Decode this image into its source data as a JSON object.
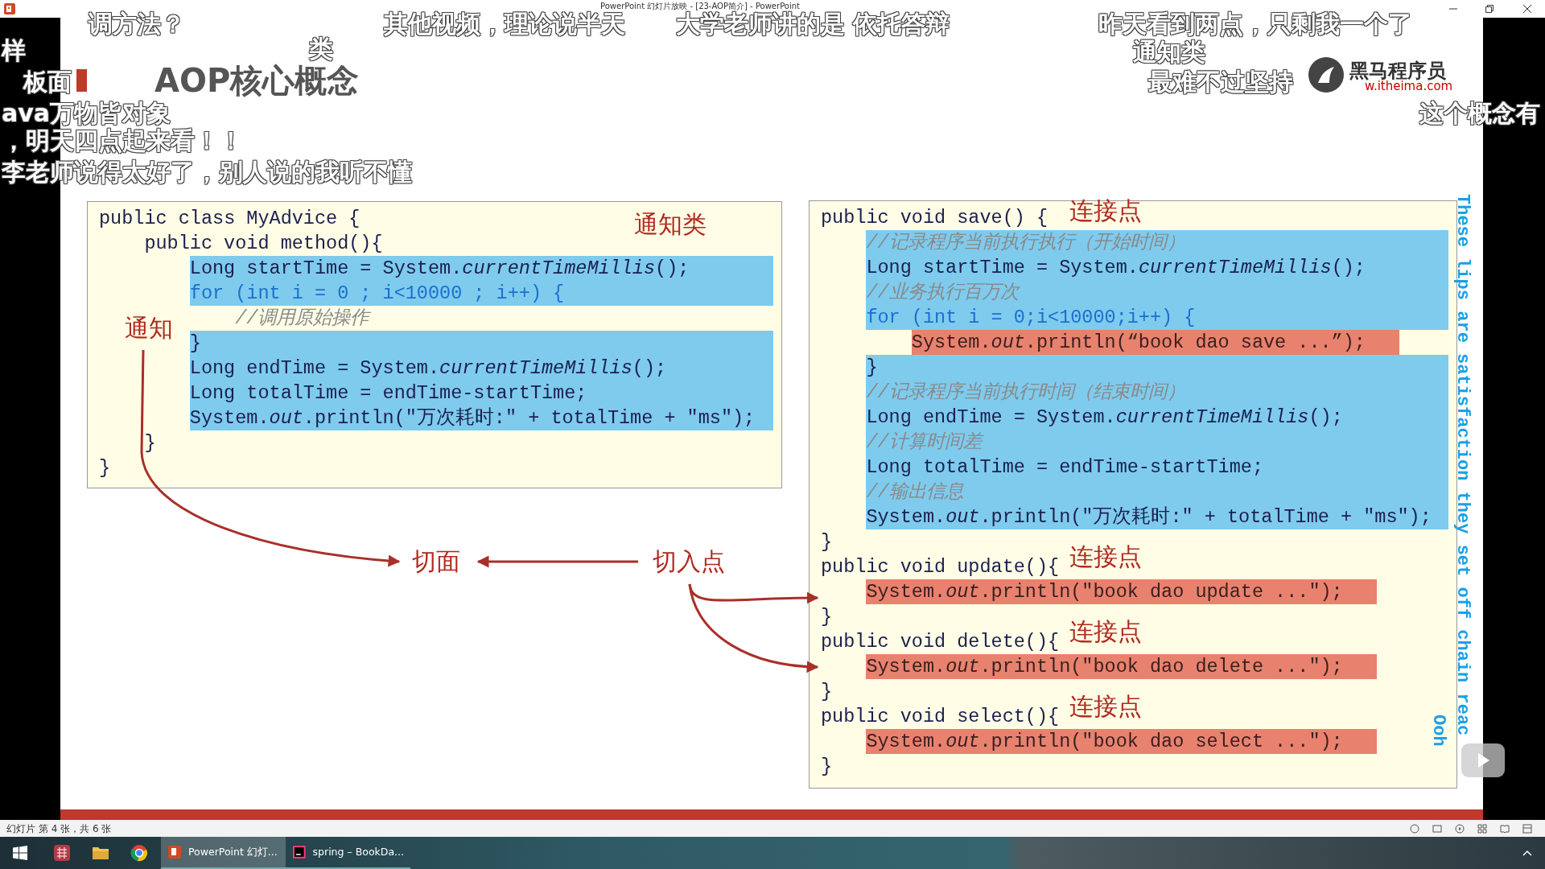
{
  "window": {
    "title": "PowerPoint 幻灯片放映 - [23-AOP简介] - PowerPoint"
  },
  "slide": {
    "title": "AOP核心概念",
    "logo": {
      "name": "黑马程序员",
      "url": "w.itheima.com"
    },
    "advice_class": {
      "lines": [
        {
          "text": "public class MyAdvice {",
          "kind": "code"
        },
        {
          "text": "    public void method(){",
          "kind": "code"
        },
        {
          "text": "        Long startTime = System.*currentTimeMillis*();",
          "kind": "code",
          "color": "#7ecbee"
        },
        {
          "text": "        for (int i = 0 ; i<10000 ; i++) {",
          "kind": "loop",
          "color": "#7ecbee"
        },
        {
          "text": "            //调用原始操作",
          "kind": "comment"
        },
        {
          "text": "        }",
          "kind": "code",
          "color": "#7ecbee"
        },
        {
          "text": "        Long endTime = System.*currentTimeMillis*();",
          "kind": "code",
          "color": "#7ecbee"
        },
        {
          "text": "        Long totalTime = endTime-startTime;",
          "kind": "code",
          "color": "#7ecbee"
        },
        {
          "text": "        System.*out*.println(\"万次耗时:\" + totalTime + \"ms\");",
          "kind": "code",
          "color": "#7ecbee"
        },
        {
          "text": "    }",
          "kind": "code"
        },
        {
          "text": "}",
          "kind": "code"
        }
      ]
    },
    "target_class": {
      "lines": [
        {
          "text": "public void save() {",
          "kind": "code"
        },
        {
          "text": "    //记录程序当前执行执行（开始时间）",
          "kind": "comment",
          "color": "#7ecbee"
        },
        {
          "text": "    Long startTime = System.*currentTimeMillis*();",
          "kind": "code",
          "color": "#7ecbee"
        },
        {
          "text": "    //业务执行百万次",
          "kind": "comment",
          "color": "#7ecbee"
        },
        {
          "text": "    for (int i = 0;i<10000;i++) {",
          "kind": "loop",
          "color": "#7ecbee"
        },
        {
          "text": "        System.*out*.println(“book dao save ...”);",
          "kind": "joinpoint",
          "color": "#e8826e"
        },
        {
          "text": "    }",
          "kind": "code",
          "color": "#7ecbee"
        },
        {
          "text": "    //记录程序当前执行时间（结束时间）",
          "kind": "comment",
          "color": "#7ecbee"
        },
        {
          "text": "    Long endTime = System.*currentTimeMillis*();",
          "kind": "code",
          "color": "#7ecbee"
        },
        {
          "text": "    //计算时间差",
          "kind": "comment",
          "color": "#7ecbee"
        },
        {
          "text": "    Long totalTime = endTime-startTime;",
          "kind": "code",
          "color": "#7ecbee"
        },
        {
          "text": "    //输出信息",
          "kind": "comment",
          "color": "#7ecbee"
        },
        {
          "text": "    System.*out*.println(\"万次耗时:\" + totalTime + \"ms\");",
          "kind": "code",
          "color": "#7ecbee"
        },
        {
          "text": "}",
          "kind": "code"
        },
        {
          "text": "public void update(){",
          "kind": "code"
        },
        {
          "text": "    System.*out*.println(\"book dao update ...\");",
          "kind": "joinpoint",
          "color": "#e8826e"
        },
        {
          "text": "}",
          "kind": "code"
        },
        {
          "text": "public void delete(){",
          "kind": "code"
        },
        {
          "text": "    System.*out*.println(\"book dao delete ...\");",
          "kind": "joinpoint",
          "color": "#e8826e"
        },
        {
          "text": "}",
          "kind": "code"
        },
        {
          "text": "public void select(){",
          "kind": "code"
        },
        {
          "text": "    System.*out*.println(\"book dao select ...\");",
          "kind": "joinpoint",
          "color": "#e8826e"
        },
        {
          "text": "}",
          "kind": "code"
        }
      ]
    },
    "labels": [
      "通知类",
      "通知",
      "切面",
      "切入点",
      "连接点",
      "连接点",
      "连接点",
      "连接点"
    ]
  },
  "comments": [
    "调方法？",
    "其他视频，理论说半天",
    "大学老师讲的是 依托答辩",
    "昨天看到两点，只剩我一个了",
    "样",
    "类",
    "通知类",
    "板面",
    "最难不过坚持",
    "ava万物皆对象",
    "这个概念有",
    "，明天四点起来看！！",
    "李老师说得太好了，别人说的我听不懂"
  ],
  "captions": [
    "These lips are satisfaction they set off chain reac",
    "Ooh"
  ],
  "status_bar": {
    "text": "幻灯片 第 4 张，共 6 张"
  },
  "taskbar": {
    "items": [
      {
        "label": "PowerPoint 幻灯...",
        "selected": true
      },
      {
        "label": "spring – BookDa...",
        "selected": false
      }
    ]
  }
}
